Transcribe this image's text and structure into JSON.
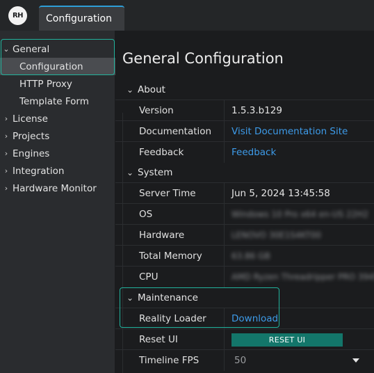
{
  "app": {
    "logo_text": "RH"
  },
  "tabs": [
    {
      "label": "Configuration",
      "active": true
    }
  ],
  "sidebar": {
    "items": [
      {
        "label": "General",
        "expanded": true
      },
      {
        "label": "Configuration",
        "selected": true
      },
      {
        "label": "HTTP Proxy"
      },
      {
        "label": "Template Form"
      },
      {
        "label": "License"
      },
      {
        "label": "Projects"
      },
      {
        "label": "Engines"
      },
      {
        "label": "Integration"
      },
      {
        "label": "Hardware Monitor"
      }
    ]
  },
  "main": {
    "title": "General Configuration",
    "sections": {
      "about": {
        "label": "About",
        "rows": [
          {
            "label": "Version",
            "value": "1.5.3.b129"
          },
          {
            "label": "Documentation",
            "value": "Visit Documentation Site"
          },
          {
            "label": "Feedback",
            "value": "Feedback"
          }
        ]
      },
      "system": {
        "label": "System",
        "rows": [
          {
            "label": "Server Time",
            "value": "Jun 5, 2024 13:45:58"
          },
          {
            "label": "OS",
            "value": "Windows 10 Pro x64 en-US 22H2"
          },
          {
            "label": "Hardware",
            "value": "LENOVO 30E1S4KT00"
          },
          {
            "label": "Total Memory",
            "value": "63.86 GB"
          },
          {
            "label": "CPU",
            "value": "AMD Ryzen Threadripper PRO 3945WX"
          }
        ]
      },
      "maintenance": {
        "label": "Maintenance",
        "rows": [
          {
            "label": "Reality Loader",
            "value": "Download"
          },
          {
            "label": "Reset UI",
            "button": "RESET UI"
          },
          {
            "label": "Timeline FPS",
            "selected": "50"
          }
        ]
      }
    }
  },
  "colors": {
    "accent_teal": "#21b39d",
    "button_teal": "#13766a",
    "link_blue": "#3d9be9",
    "tab_top": "#2e9fd8"
  }
}
